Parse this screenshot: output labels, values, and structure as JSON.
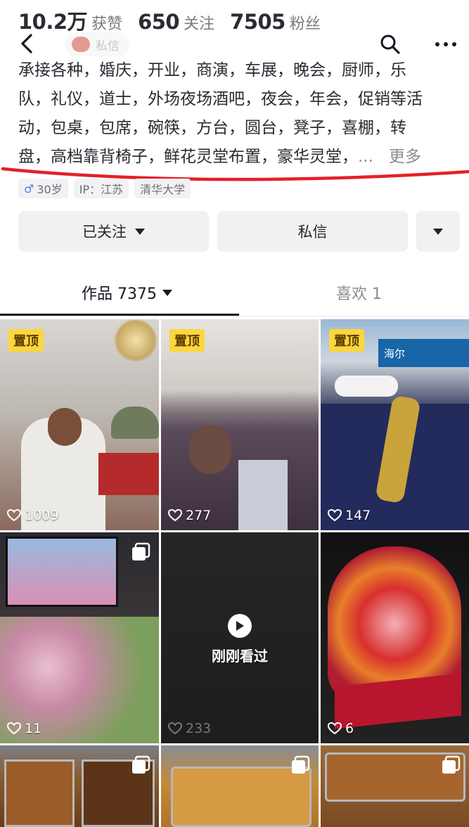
{
  "profile": {
    "stats": [
      {
        "value": "10.2万",
        "label": "获赞"
      },
      {
        "value": "650",
        "label": "关注"
      },
      {
        "value": "7505",
        "label": "粉丝"
      }
    ],
    "dm_pill_label": "私信",
    "bio_lines": [
      "承接各种，婚庆，开业，商演，车展，晚会，厨师，乐",
      "队，礼仪，道士，外场夜场酒吧，夜会，年会，促销等活",
      "动，包桌，包席，碗筷，方台，圆台，凳子，喜棚，转",
      "盘，高档靠背椅子，鲜花灵堂布置，豪华灵堂，"
    ],
    "bio_ellipsis": "...",
    "bio_more": "更多",
    "tags": {
      "gender_symbol": "♂",
      "age": "30岁",
      "ip": "IP：江苏",
      "school": "清华大学"
    }
  },
  "actions": {
    "follow_label": "已关注",
    "message_label": "私信"
  },
  "tabs": {
    "works_label": "作品 7375",
    "likes_label": "喜欢 1"
  },
  "grid": {
    "pinned_label": "置顶",
    "watched_label": "刚刚看过",
    "shop_sign": "海尔",
    "tiles": [
      {
        "likes": "1009"
      },
      {
        "likes": "277"
      },
      {
        "likes": "147"
      },
      {
        "likes": "11"
      },
      {
        "likes": "233"
      },
      {
        "likes": "6"
      }
    ]
  },
  "colors": {
    "pin_badge": "#fcd63d",
    "annotation_line": "#e3202a",
    "button_bg": "#f1f1f2"
  }
}
